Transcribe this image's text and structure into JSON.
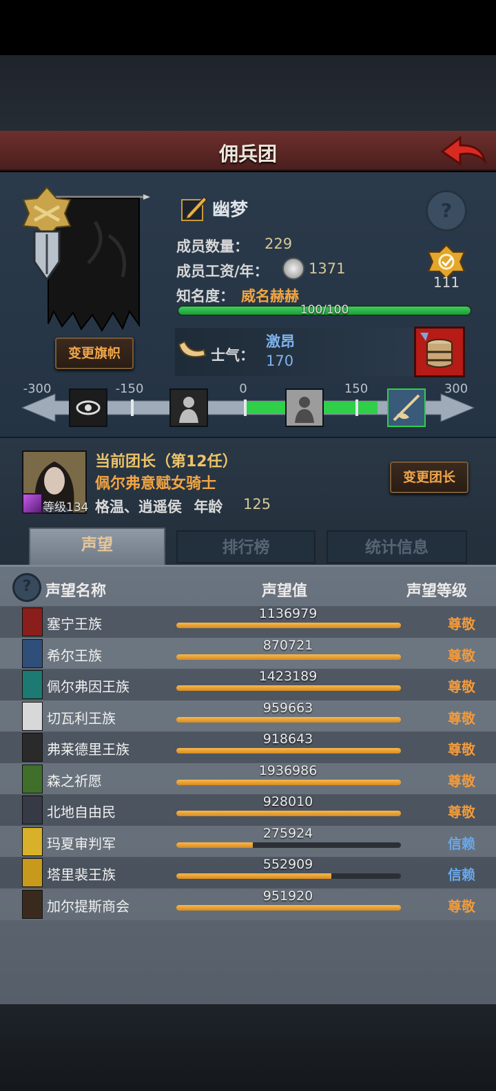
{
  "header": {
    "title": "佣兵团"
  },
  "mercenary": {
    "name": "幽梦",
    "member_count_label": "成员数量：",
    "member_count": "229",
    "salary_label": "成员工资/年：",
    "salary": "1371",
    "fame_label": "知名度：",
    "fame_value": "威名赫赫",
    "fame_progress_text": "100/100",
    "fame_progress": 1.0,
    "badge_count": "111",
    "change_banner_label": "变更旗帜"
  },
  "morale": {
    "label": "士气：",
    "word": "激昂",
    "value": "170",
    "ticks": [
      "-300",
      "-150",
      "0",
      "150",
      "300"
    ]
  },
  "leader": {
    "title": "当前团长（第12任）",
    "name": "佩尔弗意赋女骑士",
    "info": "格温、逍遥侯",
    "age_label": "年龄",
    "age": "125",
    "level_text": "等级134",
    "change_leader_label": "变更团长"
  },
  "tabs": [
    {
      "label": "声望"
    },
    {
      "label": "排行榜"
    },
    {
      "label": "统计信息"
    }
  ],
  "reputation": {
    "headers": {
      "name": "声望名称",
      "value": "声望值",
      "level": "声望等级"
    },
    "rows": [
      {
        "name": "塞宁王族",
        "value": "1136979",
        "fill": 1.0,
        "level": "尊敬"
      },
      {
        "name": "希尔王族",
        "value": "870721",
        "fill": 1.0,
        "level": "尊敬"
      },
      {
        "name": "佩尔弗因王族",
        "value": "1423189",
        "fill": 1.0,
        "level": "尊敬"
      },
      {
        "name": "切瓦利王族",
        "value": "959663",
        "fill": 1.0,
        "level": "尊敬"
      },
      {
        "name": "弗莱德里王族",
        "value": "918643",
        "fill": 1.0,
        "level": "尊敬"
      },
      {
        "name": "森之祈愿",
        "value": "1936986",
        "fill": 1.0,
        "level": "尊敬"
      },
      {
        "name": "北地自由民",
        "value": "928010",
        "fill": 1.0,
        "level": "尊敬"
      },
      {
        "name": "玛夏审判军",
        "value": "275924",
        "fill": 0.34,
        "level": "信赖"
      },
      {
        "name": "塔里裴王族",
        "value": "552909",
        "fill": 0.69,
        "level": "信赖"
      },
      {
        "name": "加尔提斯商会",
        "value": "951920",
        "fill": 1.0,
        "level": "尊敬"
      }
    ]
  },
  "colors": {
    "respect": "#f09a3c",
    "trust": "#6aa7ea"
  }
}
